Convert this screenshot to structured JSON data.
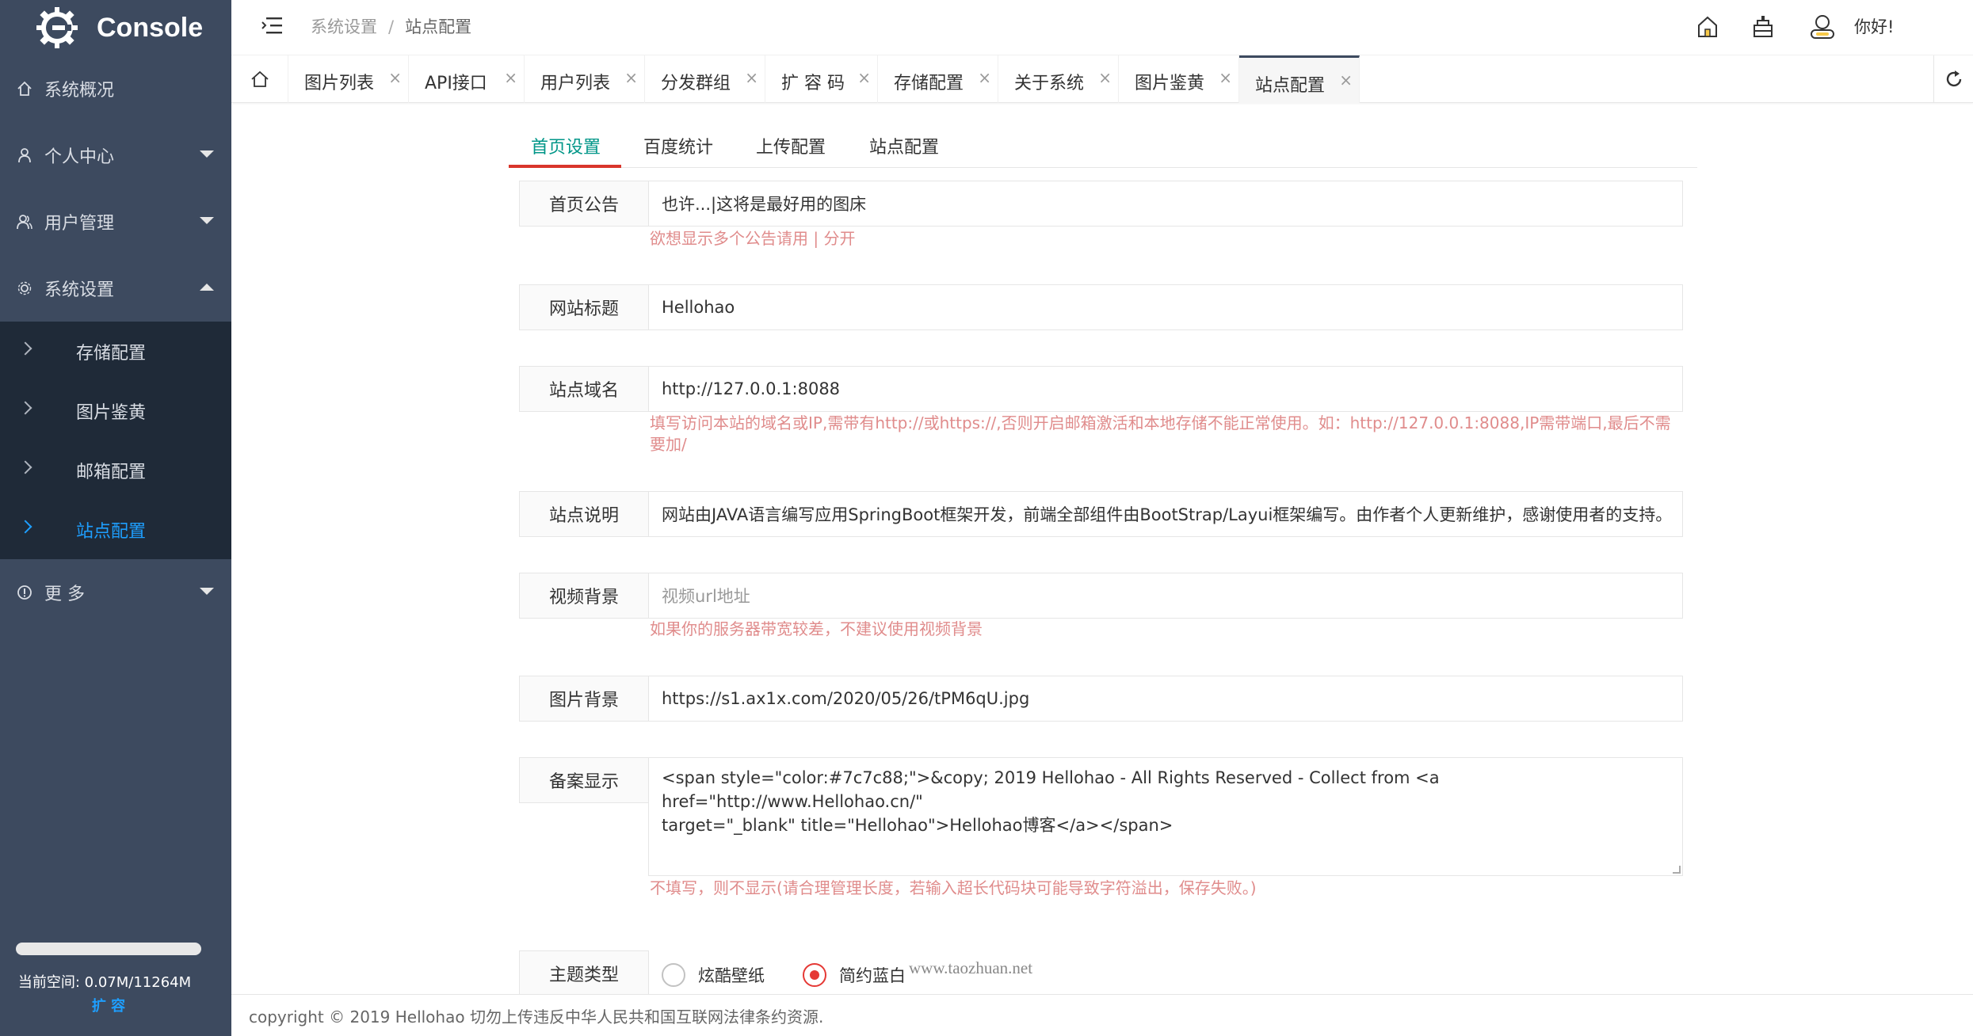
{
  "app": {
    "logo_text": "Console"
  },
  "sidebar": {
    "items": [
      {
        "label": "系统概况",
        "icon": "home-icon"
      },
      {
        "label": "个人中心",
        "icon": "user-icon"
      },
      {
        "label": "用户管理",
        "icon": "users-icon"
      },
      {
        "label": "系统设置",
        "icon": "gear-icon"
      }
    ],
    "sub_items": [
      {
        "label": "存储配置"
      },
      {
        "label": "图片鉴黄"
      },
      {
        "label": "邮箱配置"
      },
      {
        "label": "站点配置"
      }
    ],
    "more_label": "更 多",
    "space": {
      "label": "当前空间:  0.07M/11264M",
      "expand_label": "扩 容",
      "used_fraction": 6.2e-06
    }
  },
  "header": {
    "breadcrumb": {
      "parent": "系统设置",
      "separator": "/",
      "current": "站点配置"
    },
    "greeting": "你好!"
  },
  "tabs": [
    {
      "label": "图片列表"
    },
    {
      "label": "API接口"
    },
    {
      "label": "用户列表"
    },
    {
      "label": "分发群组"
    },
    {
      "label": "扩 容 码"
    },
    {
      "label": "存储配置"
    },
    {
      "label": "关于系统"
    },
    {
      "label": "图片鉴黄"
    },
    {
      "label": "站点配置"
    }
  ],
  "tab_close": "×",
  "form_tabs": [
    {
      "label": "首页设置"
    },
    {
      "label": "百度统计"
    },
    {
      "label": "上传配置"
    },
    {
      "label": "站点配置"
    }
  ],
  "form": {
    "notice": {
      "label": "首页公告",
      "value": "也许...|这将是最好用的图床",
      "hint": "欲想显示多个公告请用 | 分开"
    },
    "site_title": {
      "label": "网站标题",
      "value": "Hellohao"
    },
    "domain": {
      "label": "站点域名",
      "value": "http://127.0.0.1:8088",
      "hint_line1": "填写访问本站的域名或IP,需带有http://或https://,否则开启邮箱激活和本地存储不能正常使用。如：http://127.0.0.1:8088,IP需带端口,最后不需",
      "hint_line2": "要加/"
    },
    "description": {
      "label": "站点说明",
      "value": "网站由JAVA语言编写应用SpringBoot框架开发，前端全部组件由BootStrap/Layui框架编写。由作者个人更新维护，感谢使用者的支持。"
    },
    "video_bg": {
      "label": "视频背景",
      "placeholder": "视频url地址",
      "hint": "如果你的服务器带宽较差，不建议使用视频背景"
    },
    "image_bg": {
      "label": "图片背景",
      "value": "https://s1.ax1x.com/2020/05/26/tPM6qU.jpg"
    },
    "icp": {
      "label": "备案显示",
      "value_line1": "<span style=\"color:#7c7c88;\">&copy; 2019 Hellohao - All Rights Reserved - Collect from <a href=\"http://www.Hellohao.cn/\"",
      "value_line2": "target=\"_blank\" title=\"Hellohao\">Hellohao博客</a></span>",
      "hint": "不填写，则不显示(请合理管理长度，若输入超长代码块可能导致字符溢出，保存失败。)"
    },
    "theme": {
      "label": "主题类型",
      "options": [
        "炫酷壁纸",
        "简约蓝白"
      ],
      "selected": "简约蓝白"
    }
  },
  "watermark": "www.taozhuan.net",
  "footer": "copyright © 2019 Hellohao 切勿上传违反中华人民共和国互联网法律条约资源.",
  "colors": {
    "sidebar": "#3d4a5f",
    "submenu": "#1f2a38",
    "active": "#1e9fff",
    "tab_active": "#009688",
    "hint": "#e08c8c",
    "radio": "#e53935"
  }
}
